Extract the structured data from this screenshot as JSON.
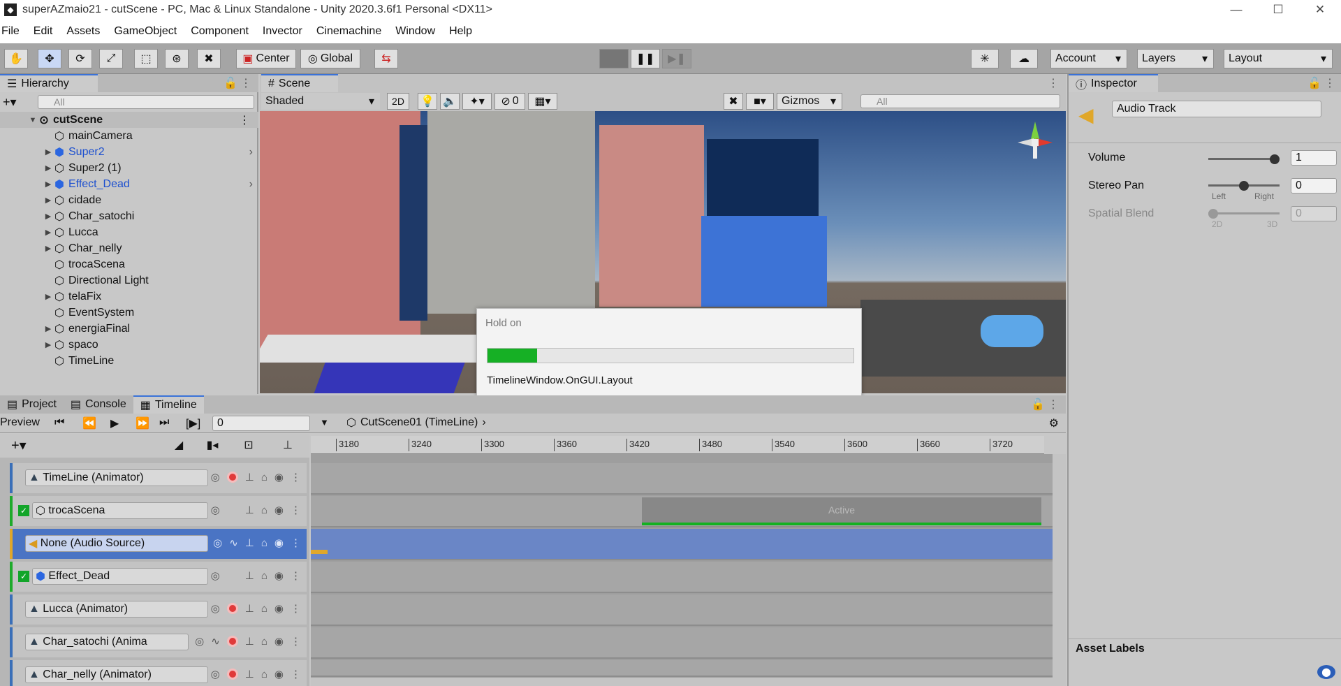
{
  "window": {
    "title": "superAZmaio21 - cutScene - PC, Mac & Linux Standalone - Unity 2020.3.6f1 Personal <DX11>",
    "minimize": "—",
    "maximize": "☐",
    "close": "✕"
  },
  "menu": [
    "File",
    "Edit",
    "Assets",
    "GameObject",
    "Component",
    "Invector",
    "Cinemachine",
    "Window",
    "Help"
  ],
  "toolbar": {
    "center_label": "Center",
    "global_label": "Global",
    "account_label": "Account",
    "layers_label": "Layers",
    "layout_label": "Layout"
  },
  "hierarchy": {
    "tab_label": "Hierarchy",
    "search_placeholder": "All",
    "scene_name": "cutScene",
    "items": [
      {
        "label": "mainCamera"
      },
      {
        "label": "Super2"
      },
      {
        "label": "Super2 (1)"
      },
      {
        "label": "Effect_Dead"
      },
      {
        "label": "cidade"
      },
      {
        "label": "Char_satochi"
      },
      {
        "label": "Lucca"
      },
      {
        "label": "Char_nelly"
      },
      {
        "label": "trocaScena"
      },
      {
        "label": "Directional Light"
      },
      {
        "label": "telaFix"
      },
      {
        "label": "EventSystem"
      },
      {
        "label": "energiaFinal"
      },
      {
        "label": "spaco"
      },
      {
        "label": "TimeLine"
      }
    ]
  },
  "scene": {
    "tab_label": "Scene",
    "shading_mode": "Shaded",
    "mode_2d": "2D",
    "hidden_count": "0",
    "gizmos_label": "Gizmos",
    "search_placeholder": "All"
  },
  "modal": {
    "title": "Hold on",
    "message": "TimelineWindow.OnGUI.Layout",
    "progress": 0.135
  },
  "bottom_tabs": {
    "project": "Project",
    "console": "Console",
    "timeline": "Timeline"
  },
  "timeline": {
    "preview_label": "Preview",
    "frame_value": "0",
    "asset_name": "CutScene01 (TimeLine)",
    "ruler_ticks": [
      "3180",
      "3240",
      "3300",
      "3360",
      "3420",
      "3480",
      "3540",
      "3600",
      "3660",
      "3720"
    ],
    "tracks": [
      {
        "label": "TimeLine (Animator)"
      },
      {
        "label": "trocaScena"
      },
      {
        "label": "None (Audio Source)"
      },
      {
        "label": "Effect_Dead"
      },
      {
        "label": "Lucca (Animator)"
      },
      {
        "label": "Char_satochi (Anima"
      },
      {
        "label": "Char_nelly (Animator)"
      }
    ],
    "active_clip_label": "Active"
  },
  "inspector": {
    "tab_label": "Inspector",
    "object_name": "Audio Track",
    "volume_label": "Volume",
    "volume_value": "1",
    "volume_level": 1.0,
    "stereo_pan_label": "Stereo Pan",
    "stereo_pan_value": "0",
    "stereo_left": "Left",
    "stereo_right": "Right",
    "stereo_level": 0.5,
    "spatial_blend_label": "Spatial Blend",
    "spatial_blend_value": "0",
    "spatial_2d": "2D",
    "spatial_3d": "3D",
    "spatial_level": 0.0,
    "asset_labels": "Asset Labels"
  },
  "colors": {
    "accent": "#3a72d8",
    "progress": "#16b025",
    "selected_track": "#4a74c4"
  }
}
